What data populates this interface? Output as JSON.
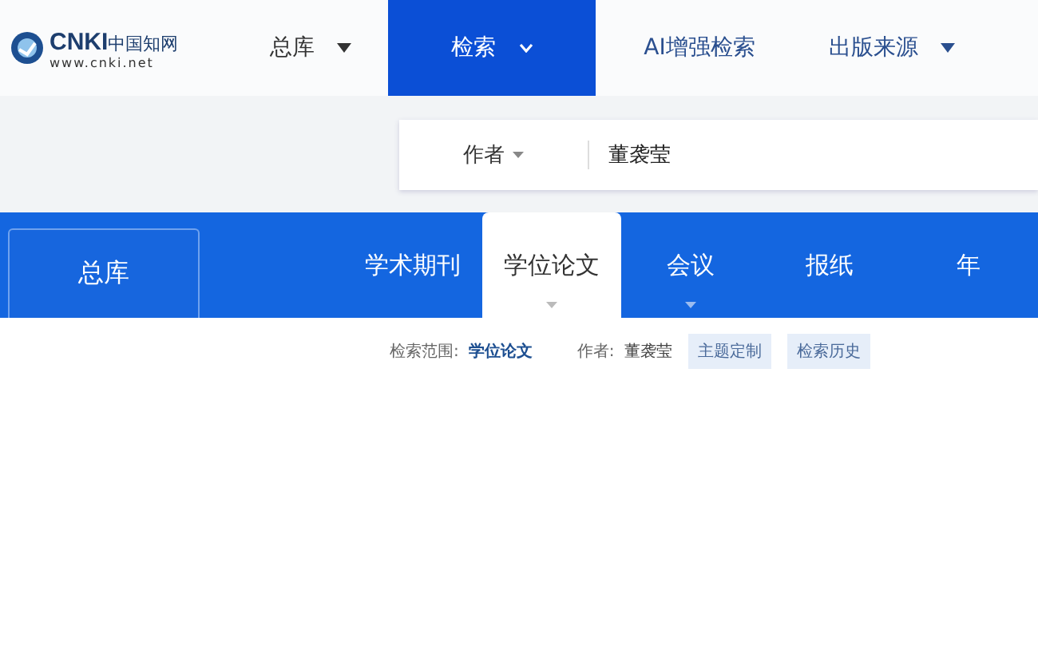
{
  "logo": {
    "mark": "CNKI",
    "name": "中国知网",
    "url": "www.cnki.net"
  },
  "nav": [
    {
      "label": "总库",
      "selected": false,
      "caret": true
    },
    {
      "label": "检索",
      "selected": true,
      "caret": true
    },
    {
      "label": "AI增强检索",
      "selected": false,
      "caret": false
    },
    {
      "label": "出版来源",
      "selected": false,
      "caret": true
    }
  ],
  "search": {
    "field": "作者",
    "value": "董袭莹"
  },
  "all_button": "总库",
  "tabs": [
    {
      "label": "学术期刊",
      "selected": false,
      "caret": false
    },
    {
      "label": "学位论文",
      "selected": true,
      "caret": true
    },
    {
      "label": "会议",
      "selected": false,
      "caret": true
    },
    {
      "label": "报纸",
      "selected": false,
      "caret": false
    },
    {
      "label": "年",
      "selected": false,
      "caret": false
    }
  ],
  "filter": {
    "scope_label": "检索范围:",
    "scope": "学位论文",
    "author_label": "作者:",
    "author": "董袭莹",
    "buttons": [
      "主题定制",
      "检索历史"
    ]
  }
}
